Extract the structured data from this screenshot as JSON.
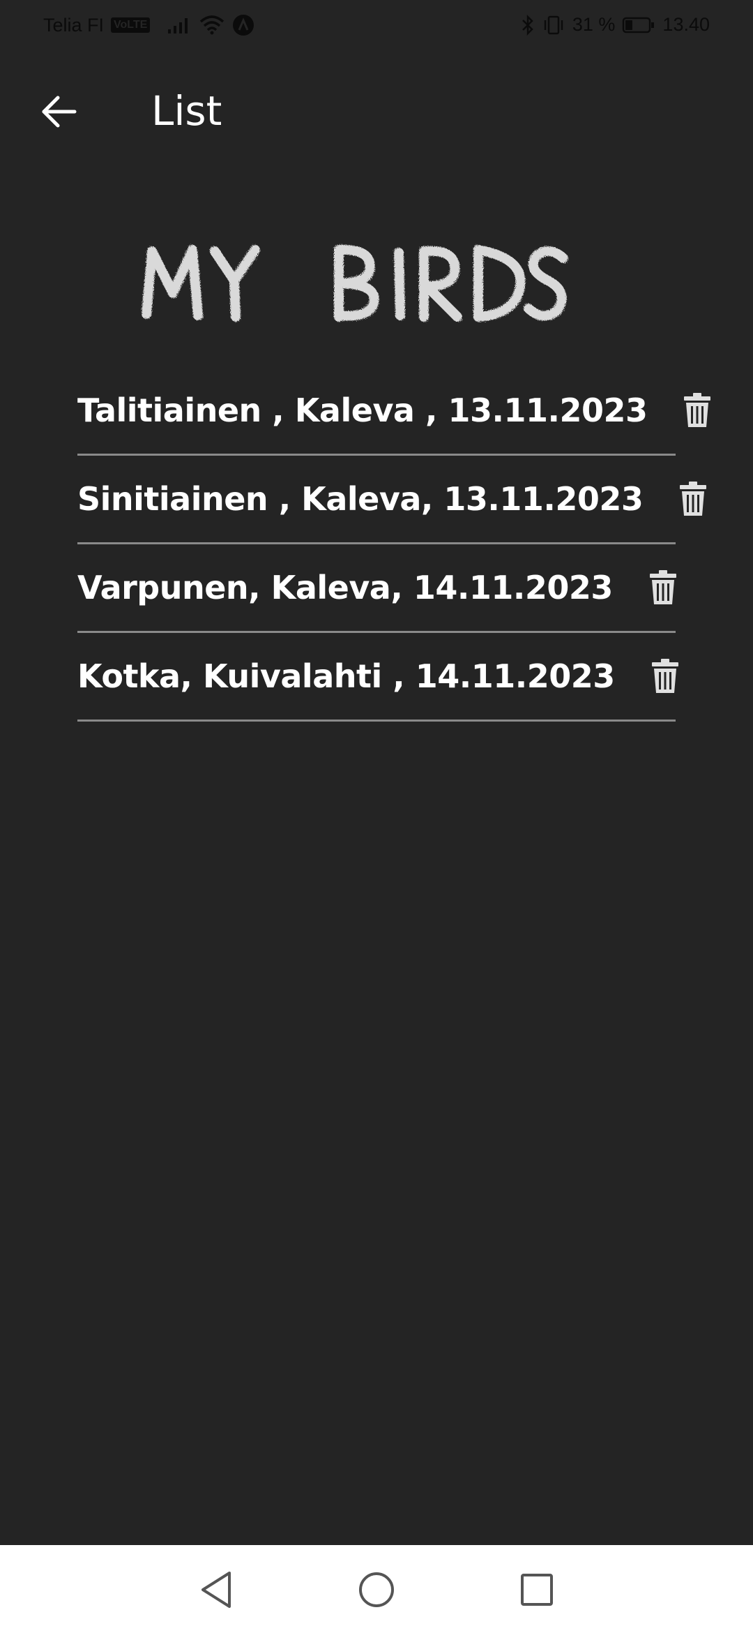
{
  "status_bar": {
    "carrier": "Telia FI",
    "volte": "VoLTE",
    "battery_percent": "31 %",
    "battery_level": 0.31,
    "time": "13.40",
    "icons": [
      "signal-icon",
      "wifi-icon",
      "notification-icon",
      "bluetooth-icon",
      "vibrate-icon",
      "battery-icon"
    ]
  },
  "app_bar": {
    "title": "List",
    "back_icon": "arrow-left-icon"
  },
  "header": {
    "logo_text": "MY BIRDS"
  },
  "birds": [
    {
      "label": "Talitiainen , Kaleva , 13.11.2023",
      "action_icon": "trash-icon"
    },
    {
      "label": "Sinitiainen , Kaleva, 13.11.2023",
      "action_icon": "trash-icon"
    },
    {
      "label": "Varpunen, Kaleva, 14.11.2023",
      "action_icon": "trash-icon"
    },
    {
      "label": "Kotka, Kuivalahti , 14.11.2023",
      "action_icon": "trash-icon"
    }
  ],
  "nav_bar": {
    "icons": [
      "back-triangle-icon",
      "home-circle-icon",
      "recents-square-icon"
    ]
  },
  "colors": {
    "background": "#242424",
    "text": "#ffffff",
    "divider": "#8a8a8a",
    "logo": "#d9d9d9",
    "nav_background": "#ffffff"
  }
}
